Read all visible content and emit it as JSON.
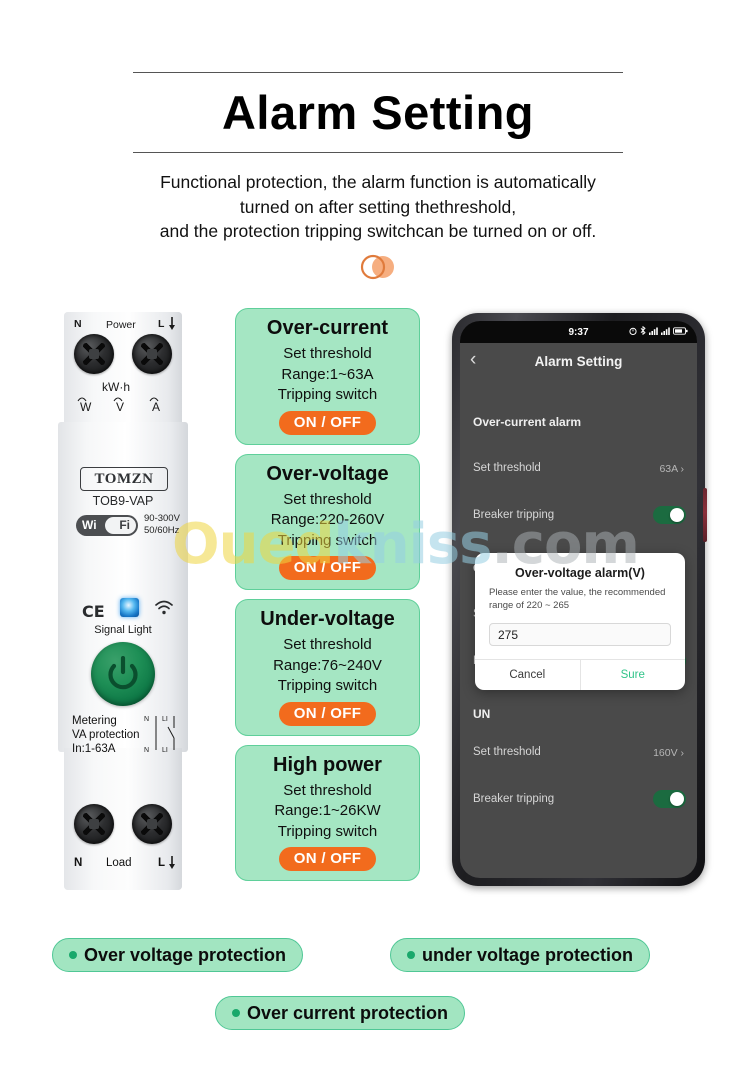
{
  "header": {
    "title": "Alarm Setting",
    "subtitle_line1": "Functional protection, the alarm function is automatically",
    "subtitle_line2": "turned on after setting thethreshold,",
    "subtitle_line3": "and the protection tripping switchcan be turned on or off."
  },
  "watermark": {
    "part1": "Oued",
    "part2": "kniss",
    "part3": ".com"
  },
  "device": {
    "top_left_terminal": "N",
    "top_center_label": "Power",
    "top_right_terminal": "L",
    "kwh": "kW·h",
    "unit_w": "W",
    "unit_v": "V",
    "unit_a": "A",
    "brand": "TOMZN",
    "model": "TOB9-VAP",
    "wifi_wi": "Wi",
    "wifi_fi": "Fi",
    "voltage_range": "90-300V",
    "frequency": "50/60Hz",
    "ce_mark": "CE",
    "signal_light": "Signal Light",
    "metering_line1": "Metering",
    "metering_line2": "VA protection",
    "metering_line3": "In:1-63A",
    "circuit_n1": "N",
    "circuit_l1": "LI",
    "circuit_n2": "N",
    "circuit_l2": "LI",
    "bottom_left_terminal": "N",
    "bottom_center_label": "Load",
    "bottom_right_terminal": "L"
  },
  "cards": [
    {
      "title": "Over-current",
      "line1": "Set threshold",
      "line2": "Range:1~63A",
      "line3": "Tripping switch",
      "pill": "ON / OFF"
    },
    {
      "title": "Over-voltage",
      "line1": "Set threshold",
      "line2": "Range:220-260V",
      "line3": "Tripping switch",
      "pill": "ON / OFF"
    },
    {
      "title": "Under-voltage",
      "line1": "Set threshold",
      "line2": "Range:76~240V",
      "line3": "Tripping switch",
      "pill": "ON / OFF"
    },
    {
      "title": "High power",
      "line1": "Set threshold",
      "line2": "Range:1~26KW",
      "line3": "Tripping switch",
      "pill": "ON / OFF"
    }
  ],
  "phone": {
    "status_time": "9:37",
    "app_title": "Alarm Setting",
    "back_icon": "‹",
    "section_overcurrent": "Over-current alarm",
    "overcurrent_threshold_label": "Set threshold",
    "overcurrent_threshold_value": "63A ›",
    "overcurrent_tripping_label": "Breaker tripping",
    "section_overvoltage_partial": "O",
    "overvoltage_threshold_partial": "Se",
    "overvoltage_tripping_partial": "Br",
    "section_undervoltage_partial": "UN",
    "undervoltage_threshold_label": "Set threshold",
    "undervoltage_threshold_value": "160V ›",
    "undervoltage_tripping_label": "Breaker tripping",
    "dialog": {
      "title": "Over-voltage alarm(V)",
      "description": "Please enter the value, the recommended range of 220 ~ 265",
      "input_value": "275",
      "cancel": "Cancel",
      "confirm": "Sure"
    }
  },
  "badges": [
    {
      "label": "Over voltage protection"
    },
    {
      "label": "under voltage protection"
    },
    {
      "label": "Over current protection"
    }
  ],
  "colors": {
    "card_bg": "#a5e6c3",
    "card_border": "#5fcf9a",
    "pill_orange": "#f26b1d",
    "toggle_green": "#1b6b40",
    "accent_sure": "#32c48a",
    "badge_dot": "#19a86b"
  }
}
